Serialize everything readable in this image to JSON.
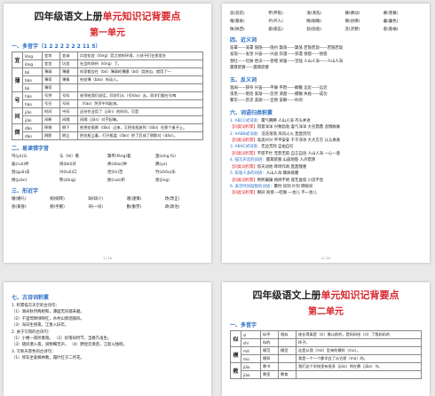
{
  "p1": {
    "title_black": "四年级语文上册",
    "title_red": "单元知识记背要点",
    "unit": "第一单元",
    "sec1": "一、多音字（1 2 2 2 2 2 2 11 5）",
    "poly_table": [
      {
        "ch": "宜",
        "rows": [
          [
            "lóng",
            "宜宾",
            "宜诚",
            "口宜化宜（lóng）音之地的环境，小孩子们在那里办"
          ],
          [
            "lòng",
            "宜宜",
            "坑宜",
            "社会的场所（lóng）了。"
          ]
        ]
      },
      {
        "ch": "薄",
        "rows": [
          [
            "bó",
            "薄弱",
            "薄膜",
            "你家都会在（bó）薄弱的薄膜（bó）饶饼边，就用了一"
          ],
          [
            "báo",
            "薄荷",
            "薄情",
            "些较薄（báo）的动人。"
          ],
          [
            "bò",
            "薄荷",
            "",
            " "
          ]
        ]
      },
      {
        "ch": "号",
        "rows": [
          [
            "háo",
            "号哭",
            "号叫",
            "老师给我们说话，同学们从（号háo）去。同学们都在号啕"
          ],
          [
            "hào",
            "号召",
            "号码",
            "（hào）哭声中叫起来。"
          ]
        ]
      },
      {
        "ch": "间",
        "rows": [
          [
            "jiān",
            "时间",
            "中间",
            "这份作业用了（jiān）的时间，可是"
          ],
          [
            "jiàn",
            "间断",
            "间隔",
            "间隔（jiàn）对不起嘛。"
          ]
        ]
      },
      {
        "ch": "倒",
        "rows": [
          [
            "dǎo",
            "摔倒",
            "倒下",
            "他把花瓶倒（dào）过来，又把花瓶放到（dǎo）在那个桌子上。"
          ],
          [
            "dào",
            "倒影",
            "倒立",
            "把花瓶立着，打开瓶盖（dào）把了后成了倒影对（dǎo）。"
          ]
        ]
      }
    ],
    "sec2": "二、易读错字音",
    "easy_words": [
      "呜(yǔ)么",
      "与（tè）看",
      "飘传(fēng)着",
      "蛋(xìng fú)",
      "羞(ruò)杯",
      "尚(bèi)开",
      "秀(diào)钟",
      "隅(yú)",
      "刮(guā)去",
      "兴(tuō)口",
      "泄(lín)苦",
      "竹(shǒu)乐",
      "倦(juàn)",
      "熊(zōng)",
      "挫(cuò)折",
      "竟(jìng)"
    ],
    "sec3": "三、形近字",
    "similar": [
      [
        "婚(婚礼)",
        "婉(婉转)",
        "缺(缺少)",
        "谨(谨慎)",
        "改(改正)"
      ],
      [
        "昏(黄昏)",
        "腕(手腕)",
        "块(一块)",
        "勤(勤劳)",
        "政(政治)"
      ]
    ],
    "pnum": "1 / 10"
  },
  "p2": {
    "top_rows": [
      [
        "浪(浪花)",
        "怀(怀抱)",
        "清(清洗)",
        "拂(拂动)",
        "慕(羡慕)"
      ],
      [
        "粮(粮食)",
        "坏(坏人)",
        "睛(眼睛)",
        "佛(仿佛)",
        "暮(暮色)"
      ],
      [
        "陕(陕西)",
        "袭(袭击)",
        "勃(勃勃)",
        "贪(贪婪)",
        "惹(惹祸)"
      ]
    ],
    "sec4": "四、近义词",
    "synonyms": [
      "笼罩——笼罩     隐隐——隐约     飘荡——飘荡     若隐若现——若隐若现",
      "发现——发觉     兴奋——兴奋     弥漫——弥漫     恍惚——恍惚",
      "吞吐——吐纳     吞没——吞噬     顽强——坚强     人山人海——人山人海",
      "震耳欲聋——震耳欲聋"
    ],
    "sec5": "五、反义词",
    "antonyms": [
      "宽阔——狭窄     兴奋——平静     平稳——颠簸     远近——远近",
      "漆黑——明亮     渐渐——忽然     清楚——模糊     失败——成功",
      "繁华——荒凉     美丽——丑陋     安静——吵闹"
    ],
    "sec6": "六、词语归类积累",
    "items": [
      {
        "tag": "1. ABCC式词语：",
        "text": "雾气腾腾   人山人海   齐头并进"
      },
      {
        "tag": "【同类词积累】",
        "text": "得意洋洋  兴致勃勃  喜气洋洋  大名鼎鼎  含情脉脉"
      },
      {
        "tag": "2. AABB式词语：",
        "text": "浩浩荡荡  风风火火  轰轰烈烈"
      },
      {
        "tag": "【同类词积累】",
        "text": "高高兴兴  平平安安  干干净净  大大方方  认认真真"
      },
      {
        "tag": "3. ABAC式词语：",
        "text": "无边无际  自由自在"
      },
      {
        "tag": "【同类词积累】",
        "text": "不慌不忙  无影无踪  自言自语  人山人海  一心一意"
      },
      {
        "tag": "4. 描写声音的词语：",
        "text": "震耳欲聋  山崩地裂  人声鼎沸"
      },
      {
        "tag": "【同类词积累】",
        "text": "惊天动地  哗哗作响  轰轰隆隆"
      },
      {
        "tag": "5. 形容人多的词语：",
        "text": "人山人海  摩肩接踵"
      },
      {
        "tag": "【同类词积累】",
        "text": "熙熙攘攘  络绎不绝  座无虚席  川流不息"
      },
      {
        "tag": "6. 表示时间短暂的词语：",
        "text": "霎时  顷刻  片刻  转眼间"
      },
      {
        "tag": "【同类词积累】",
        "text": "瞬间  刹那  一眨眼  一会儿  不一会儿"
      }
    ],
    "pnum": "2 / 10"
  },
  "p3": {
    "sec7": "七、古诗词积累",
    "lines": [
      "1. 积累描写天空的古诗句：",
      "（1）湖光秋月两相和，潭面无风镜未磨。",
      "（2）千里莺啼绿映红，水村山郭酒旗风。",
      "（3）海日生残夜，江春入旧年。",
      "2. 关于写雨的古诗句：",
      "（1）小楼一夜听春雨。  （2）好雨知时节，当春乃发生。",
      "（3）随风潜入夜，润物细无声。  （4）野径云俱黑，江船火独明。",
      "3. 写秋天景色的古诗句：",
      "（1）停车坐爱枫林晚，霜叶红于二月花。"
    ]
  },
  "p4": {
    "title_black": "四年级语文上册",
    "title_red": "单元知识记背要点",
    "unit": "第二单元",
    "sec1": "一、多音字",
    "poly_table": [
      {
        "ch": "似",
        "rows": [
          [
            "sì",
            "似乎",
            "相似",
            "她长得真是（sì）像以前的，是妈妈给（sì）了我妈妈的"
          ],
          [
            "shì",
            "似的",
            "",
            "样子。"
          ]
        ]
      },
      {
        "ch": "模",
        "rows": [
          [
            "mó",
            "模范",
            "模型",
            "这是从我（mó）型来的模样（mú）。"
          ],
          [
            "mú",
            "模样",
            "",
            "我是一个一个都学会了从它呢（mú）的。"
          ]
        ]
      },
      {
        "ch": "教",
        "rows": [
          [
            "jiāo",
            "教书",
            "",
            "我们这个学校里有很多（jiào）师在教（jiāo）书。"
          ],
          [
            "jiào",
            "教室",
            "教育",
            ""
          ]
        ]
      }
    ]
  }
}
